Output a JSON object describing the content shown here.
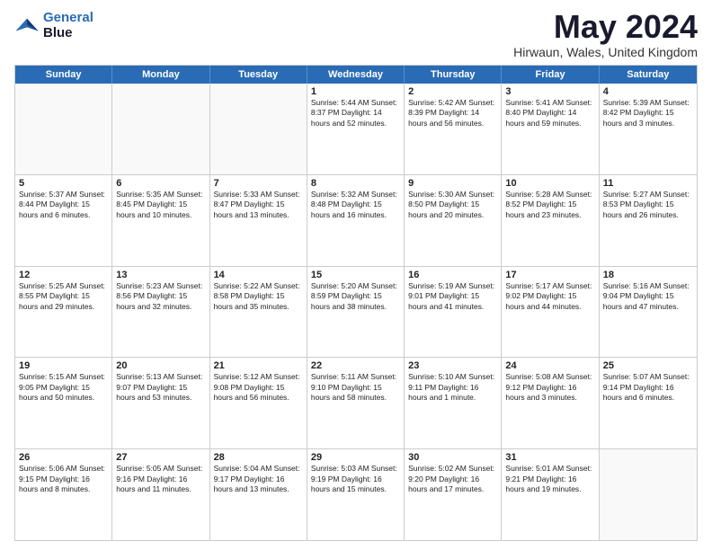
{
  "logo": {
    "line1": "General",
    "line2": "Blue"
  },
  "title": "May 2024",
  "location": "Hirwaun, Wales, United Kingdom",
  "days_of_week": [
    "Sunday",
    "Monday",
    "Tuesday",
    "Wednesday",
    "Thursday",
    "Friday",
    "Saturday"
  ],
  "weeks": [
    [
      {
        "day": "",
        "info": ""
      },
      {
        "day": "",
        "info": ""
      },
      {
        "day": "",
        "info": ""
      },
      {
        "day": "1",
        "info": "Sunrise: 5:44 AM\nSunset: 8:37 PM\nDaylight: 14 hours\nand 52 minutes."
      },
      {
        "day": "2",
        "info": "Sunrise: 5:42 AM\nSunset: 8:39 PM\nDaylight: 14 hours\nand 56 minutes."
      },
      {
        "day": "3",
        "info": "Sunrise: 5:41 AM\nSunset: 8:40 PM\nDaylight: 14 hours\nand 59 minutes."
      },
      {
        "day": "4",
        "info": "Sunrise: 5:39 AM\nSunset: 8:42 PM\nDaylight: 15 hours\nand 3 minutes."
      }
    ],
    [
      {
        "day": "5",
        "info": "Sunrise: 5:37 AM\nSunset: 8:44 PM\nDaylight: 15 hours\nand 6 minutes."
      },
      {
        "day": "6",
        "info": "Sunrise: 5:35 AM\nSunset: 8:45 PM\nDaylight: 15 hours\nand 10 minutes."
      },
      {
        "day": "7",
        "info": "Sunrise: 5:33 AM\nSunset: 8:47 PM\nDaylight: 15 hours\nand 13 minutes."
      },
      {
        "day": "8",
        "info": "Sunrise: 5:32 AM\nSunset: 8:48 PM\nDaylight: 15 hours\nand 16 minutes."
      },
      {
        "day": "9",
        "info": "Sunrise: 5:30 AM\nSunset: 8:50 PM\nDaylight: 15 hours\nand 20 minutes."
      },
      {
        "day": "10",
        "info": "Sunrise: 5:28 AM\nSunset: 8:52 PM\nDaylight: 15 hours\nand 23 minutes."
      },
      {
        "day": "11",
        "info": "Sunrise: 5:27 AM\nSunset: 8:53 PM\nDaylight: 15 hours\nand 26 minutes."
      }
    ],
    [
      {
        "day": "12",
        "info": "Sunrise: 5:25 AM\nSunset: 8:55 PM\nDaylight: 15 hours\nand 29 minutes."
      },
      {
        "day": "13",
        "info": "Sunrise: 5:23 AM\nSunset: 8:56 PM\nDaylight: 15 hours\nand 32 minutes."
      },
      {
        "day": "14",
        "info": "Sunrise: 5:22 AM\nSunset: 8:58 PM\nDaylight: 15 hours\nand 35 minutes."
      },
      {
        "day": "15",
        "info": "Sunrise: 5:20 AM\nSunset: 8:59 PM\nDaylight: 15 hours\nand 38 minutes."
      },
      {
        "day": "16",
        "info": "Sunrise: 5:19 AM\nSunset: 9:01 PM\nDaylight: 15 hours\nand 41 minutes."
      },
      {
        "day": "17",
        "info": "Sunrise: 5:17 AM\nSunset: 9:02 PM\nDaylight: 15 hours\nand 44 minutes."
      },
      {
        "day": "18",
        "info": "Sunrise: 5:16 AM\nSunset: 9:04 PM\nDaylight: 15 hours\nand 47 minutes."
      }
    ],
    [
      {
        "day": "19",
        "info": "Sunrise: 5:15 AM\nSunset: 9:05 PM\nDaylight: 15 hours\nand 50 minutes."
      },
      {
        "day": "20",
        "info": "Sunrise: 5:13 AM\nSunset: 9:07 PM\nDaylight: 15 hours\nand 53 minutes."
      },
      {
        "day": "21",
        "info": "Sunrise: 5:12 AM\nSunset: 9:08 PM\nDaylight: 15 hours\nand 56 minutes."
      },
      {
        "day": "22",
        "info": "Sunrise: 5:11 AM\nSunset: 9:10 PM\nDaylight: 15 hours\nand 58 minutes."
      },
      {
        "day": "23",
        "info": "Sunrise: 5:10 AM\nSunset: 9:11 PM\nDaylight: 16 hours\nand 1 minute."
      },
      {
        "day": "24",
        "info": "Sunrise: 5:08 AM\nSunset: 9:12 PM\nDaylight: 16 hours\nand 3 minutes."
      },
      {
        "day": "25",
        "info": "Sunrise: 5:07 AM\nSunset: 9:14 PM\nDaylight: 16 hours\nand 6 minutes."
      }
    ],
    [
      {
        "day": "26",
        "info": "Sunrise: 5:06 AM\nSunset: 9:15 PM\nDaylight: 16 hours\nand 8 minutes."
      },
      {
        "day": "27",
        "info": "Sunrise: 5:05 AM\nSunset: 9:16 PM\nDaylight: 16 hours\nand 11 minutes."
      },
      {
        "day": "28",
        "info": "Sunrise: 5:04 AM\nSunset: 9:17 PM\nDaylight: 16 hours\nand 13 minutes."
      },
      {
        "day": "29",
        "info": "Sunrise: 5:03 AM\nSunset: 9:19 PM\nDaylight: 16 hours\nand 15 minutes."
      },
      {
        "day": "30",
        "info": "Sunrise: 5:02 AM\nSunset: 9:20 PM\nDaylight: 16 hours\nand 17 minutes."
      },
      {
        "day": "31",
        "info": "Sunrise: 5:01 AM\nSunset: 9:21 PM\nDaylight: 16 hours\nand 19 minutes."
      },
      {
        "day": "",
        "info": ""
      }
    ]
  ]
}
